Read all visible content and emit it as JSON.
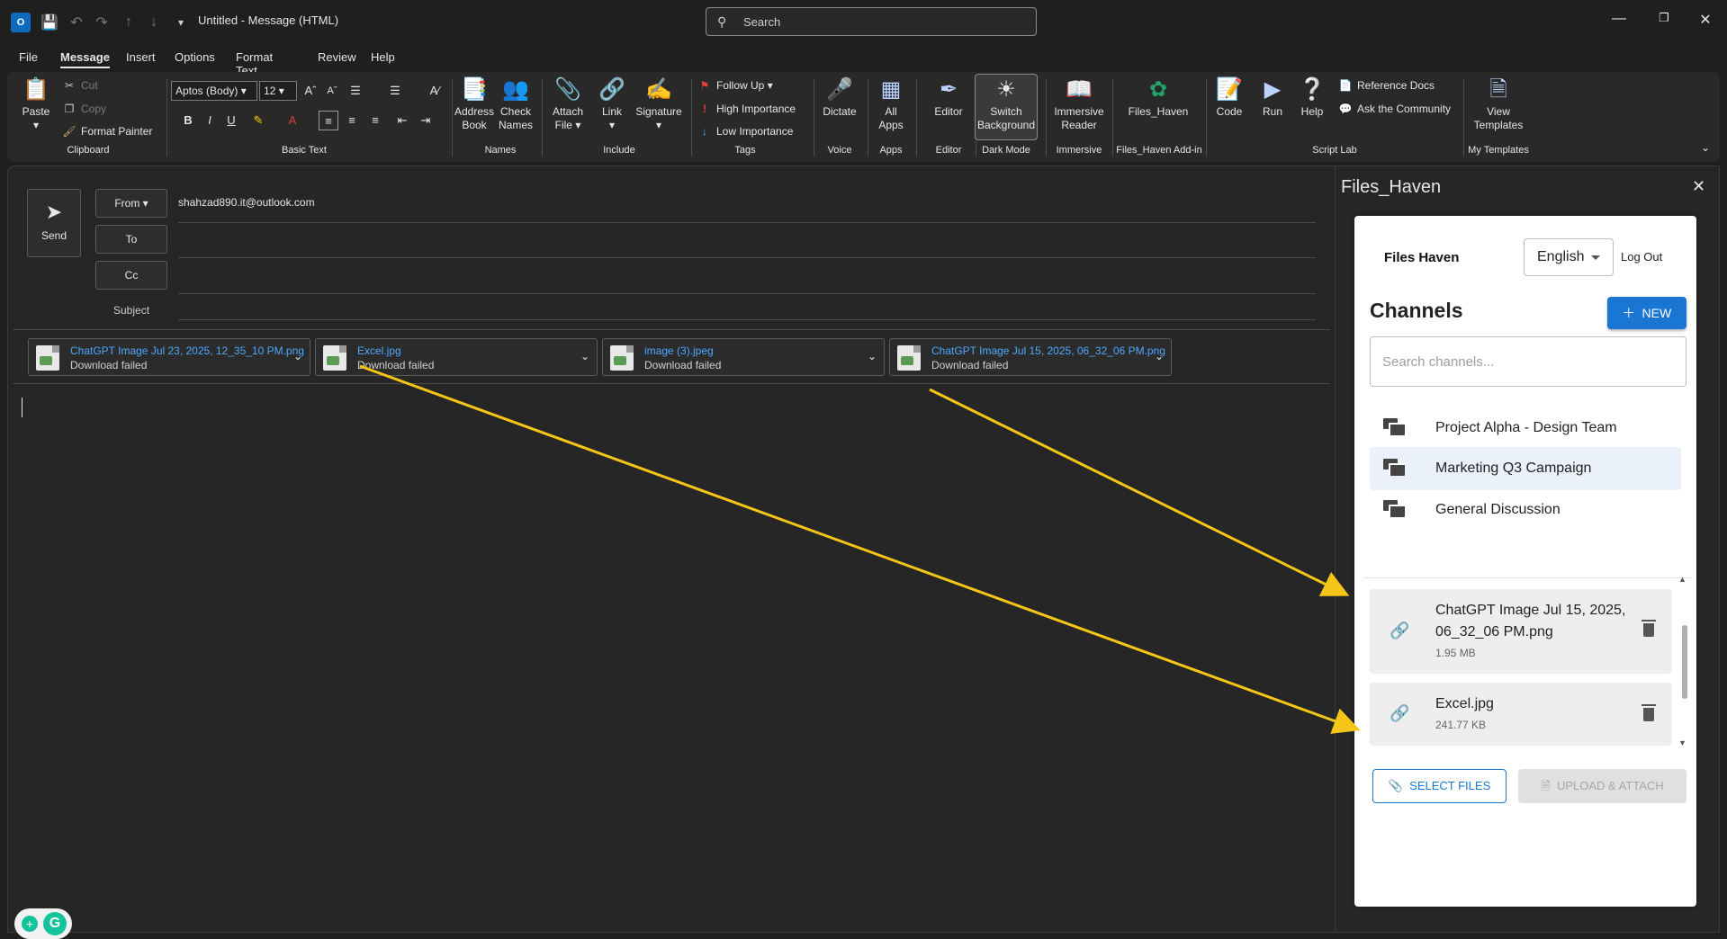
{
  "titlebar": {
    "title": "Untitled  -  Message (HTML)",
    "search_placeholder": "Search"
  },
  "menu": {
    "tabs": [
      "File",
      "Message",
      "Insert",
      "Options",
      "Format Text",
      "Review",
      "Help"
    ],
    "active": "Message"
  },
  "ribbon": {
    "clipboard": {
      "paste": "Paste",
      "cut": "Cut",
      "copy": "Copy",
      "format_painter": "Format Painter",
      "label": "Clipboard"
    },
    "basic_text": {
      "font": "Aptos (Body)",
      "size": "12",
      "label": "Basic Text"
    },
    "names": {
      "address_book_1": "Address",
      "address_book_2": "Book",
      "check_names_1": "Check",
      "check_names_2": "Names",
      "label": "Names"
    },
    "include": {
      "attach_1": "Attach",
      "attach_2": "File",
      "link": "Link",
      "signature": "Signature",
      "label": "Include"
    },
    "tags": {
      "follow_up": "Follow Up",
      "high": "High Importance",
      "low": "Low Importance",
      "label": "Tags"
    },
    "voice": {
      "dictate": "Dictate",
      "label": "Voice"
    },
    "apps": {
      "all_1": "All",
      "all_2": "Apps",
      "label": "Apps"
    },
    "editor": {
      "editor": "Editor",
      "label": "Editor"
    },
    "dark_mode": {
      "switch_1": "Switch",
      "switch_2": "Background",
      "label": "Dark Mode"
    },
    "immersive": {
      "r1": "Immersive",
      "r2": "Reader",
      "label": "Immersive"
    },
    "files_haven": {
      "btn": "Files_Haven",
      "label": "Files_Haven Add-in"
    },
    "script_lab": {
      "code": "Code",
      "run": "Run",
      "help": "Help",
      "ref": "Reference Docs",
      "ask": "Ask the Community",
      "label": "Script Lab"
    },
    "templates": {
      "view_1": "View",
      "view_2": "Templates",
      "label": "My Templates"
    }
  },
  "compose": {
    "send": "Send",
    "from_label": "From",
    "from_value": "shahzad890.it@outlook.com",
    "to_label": "To",
    "cc_label": "Cc",
    "subject_label": "Subject",
    "attachments": [
      {
        "name": "ChatGPT Image Jul 23, 2025, 12_35_10 PM.png",
        "status": "Download failed"
      },
      {
        "name": "Excel.jpg",
        "status": "Download failed"
      },
      {
        "name": "image (3).jpeg",
        "status": "Download failed"
      },
      {
        "name": "ChatGPT Image Jul 15, 2025, 06_32_06 PM.png",
        "status": "Download failed"
      }
    ]
  },
  "addin": {
    "pane_title": "Files_Haven",
    "brand": "Files Haven",
    "language": "English",
    "logout": "Log Out",
    "channels_heading": "Channels",
    "new_button": "NEW",
    "search_placeholder": "Search channels...",
    "channels": [
      "Project Alpha - Design Team",
      "Marketing Q3 Campaign",
      "General Discussion"
    ],
    "selected_channel": "Marketing Q3 Campaign",
    "files": [
      {
        "name_1": "ChatGPT Image Jul 15, 2025,",
        "name_2": "06_32_06 PM.png",
        "size": "1.95 MB"
      },
      {
        "name_1": "Excel.jpg",
        "size": "241.77 KB"
      }
    ],
    "select_files": "SELECT FILES",
    "upload_attach": "UPLOAD & ATTACH"
  },
  "colors": {
    "accent": "#1976d2",
    "link": "#4ea8ff",
    "arrow": "#f5c518",
    "background": "#1f1f1f"
  }
}
